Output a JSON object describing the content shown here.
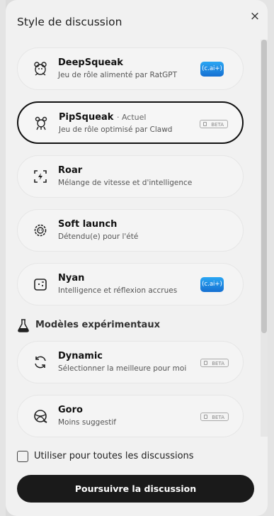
{
  "dialog": {
    "title": "Style de discussion",
    "close_icon": "×"
  },
  "models": [
    {
      "name": "DeepSqueak",
      "subtitle": "Jeu de rôle alimenté par RatGPT",
      "badge": "(c.ai+)",
      "icon": "deepsqueak-icon"
    },
    {
      "name": "PipSqueak",
      "current": "· Actuel",
      "subtitle": "Jeu de rôle optimisé par Clawd",
      "badge": "BETA",
      "icon": "pipsqueak-icon"
    },
    {
      "name": "Roar",
      "subtitle": "Mélange de vitesse et d'intelligence",
      "icon": "roar-icon"
    },
    {
      "name": "Soft launch",
      "subtitle": "Détendu(e) pour l'été",
      "icon": "soft-launch-icon"
    },
    {
      "name": "Nyan",
      "subtitle": "Intelligence et réflexion accrues",
      "badge": "(c.ai+)",
      "icon": "nyan-icon"
    }
  ],
  "experimental_section": {
    "label": "Modèles expérimentaux",
    "icon": "flask-icon"
  },
  "experimental_models": [
    {
      "name": "Dynamic",
      "subtitle": "Sélectionner la meilleure pour moi",
      "badge": "BETA",
      "icon": "refresh-icon"
    },
    {
      "name": "Goro",
      "subtitle": "Moins suggestif",
      "badge": "BETA",
      "icon": "goro-icon"
    }
  ],
  "checkbox": {
    "label": "Utiliser pour toutes les discussions",
    "checked": false
  },
  "cta": {
    "label": "Poursuivre la discussion"
  },
  "colors": {
    "cai_badge": "#1e88e5",
    "cta_bg": "#1a1a1a",
    "selected_border": "#111111"
  }
}
